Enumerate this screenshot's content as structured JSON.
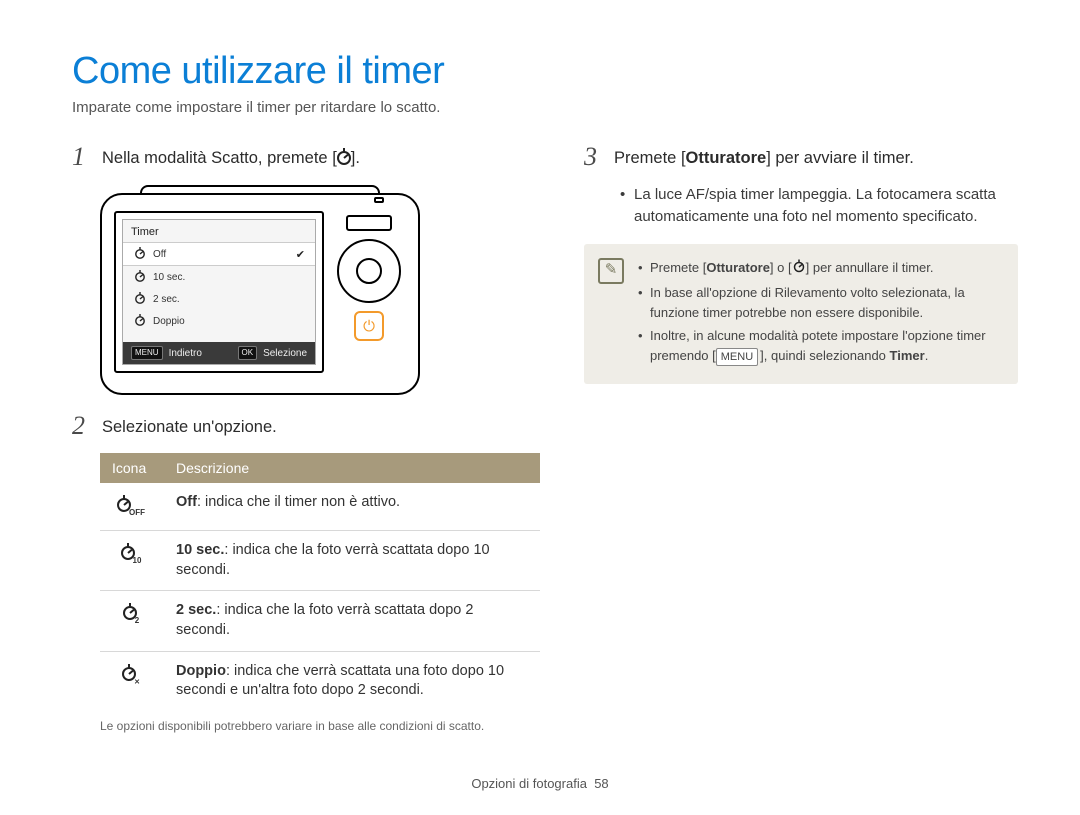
{
  "title": "Come utilizzare il timer",
  "subtitle": "Imparate come impostare il timer per ritardare lo scatto.",
  "steps": {
    "s1": {
      "num": "1",
      "text_before": "Nella modalità Scatto, premete [",
      "text_after": "]."
    },
    "s2": {
      "num": "2",
      "text": "Selezionate un'opzione."
    },
    "s3": {
      "num": "3",
      "text_before": "Premete [",
      "bold": "Otturatore",
      "text_after": "] per avviare il timer."
    }
  },
  "camera_menu": {
    "title": "Timer",
    "items": [
      "Off",
      "10 sec.",
      "2 sec.",
      "Doppio"
    ],
    "footer_left_tag": "MENU",
    "footer_left": "Indietro",
    "footer_right_tag": "OK",
    "footer_right": "Selezione"
  },
  "table": {
    "head_icon": "Icona",
    "head_desc": "Descrizione",
    "rows": [
      {
        "icon_sub": "OFF",
        "bold": "Off",
        "rest": ": indica che il timer non è attivo."
      },
      {
        "icon_sub": "10",
        "bold": "10 sec.",
        "rest": ": indica che la foto verrà scattata dopo 10 secondi."
      },
      {
        "icon_sub": "2",
        "bold": "2 sec.",
        "rest": ": indica che la foto verrà scattata dopo 2 secondi."
      },
      {
        "icon_sub": "✕",
        "bold": "Doppio",
        "rest": ": indica che verrà scattata una foto dopo 10 secondi e un'altra foto dopo 2 secondi."
      }
    ]
  },
  "table_footnote": "Le opzioni disponibili potrebbero variare in base alle condizioni di scatto.",
  "step3_bullets": [
    "La luce AF/spia timer lampeggia. La fotocamera scatta automaticamente una foto nel momento specificato."
  ],
  "note": {
    "n1_a": "Premete [",
    "n1_bold": "Otturatore",
    "n1_b": "] o [",
    "n1_c": "] per annullare il timer.",
    "n2": "In base all'opzione di Rilevamento volto selezionata, la funzione timer potrebbe non essere disponibile.",
    "n3_a": "Inoltre, in alcune modalità potete impostare l'opzione timer premendo [",
    "n3_menu": "MENU",
    "n3_b": "], quindi selezionando ",
    "n3_bold": "Timer",
    "n3_c": "."
  },
  "footer": {
    "section": "Opzioni di fotografia",
    "page": "58"
  }
}
